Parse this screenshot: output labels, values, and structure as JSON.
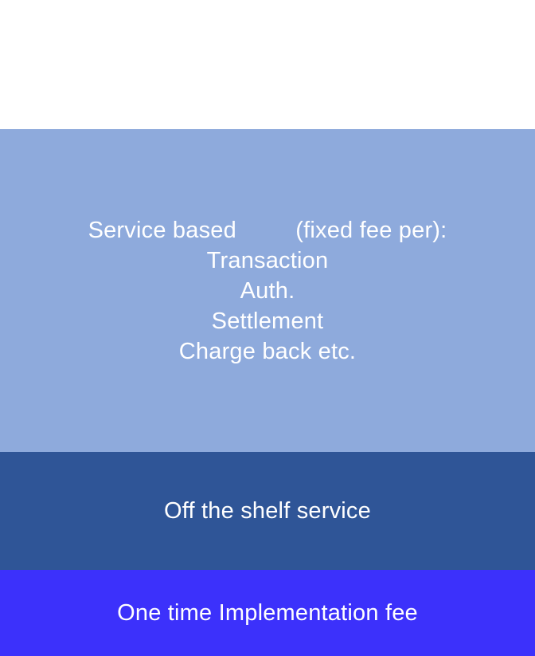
{
  "blocks": {
    "service": {
      "lines": [
        "Service based         (fixed fee per):",
        "Transaction",
        "Auth.",
        "Settlement",
        "Charge back etc."
      ]
    },
    "shelf": {
      "label": "Off the shelf service"
    },
    "implementation": {
      "label": "One time Implementation fee"
    }
  },
  "colors": {
    "service_block": "#8eaadc",
    "shelf_block": "#2f5597",
    "implementation_block": "#3c31fb",
    "text": "#ffffff"
  }
}
